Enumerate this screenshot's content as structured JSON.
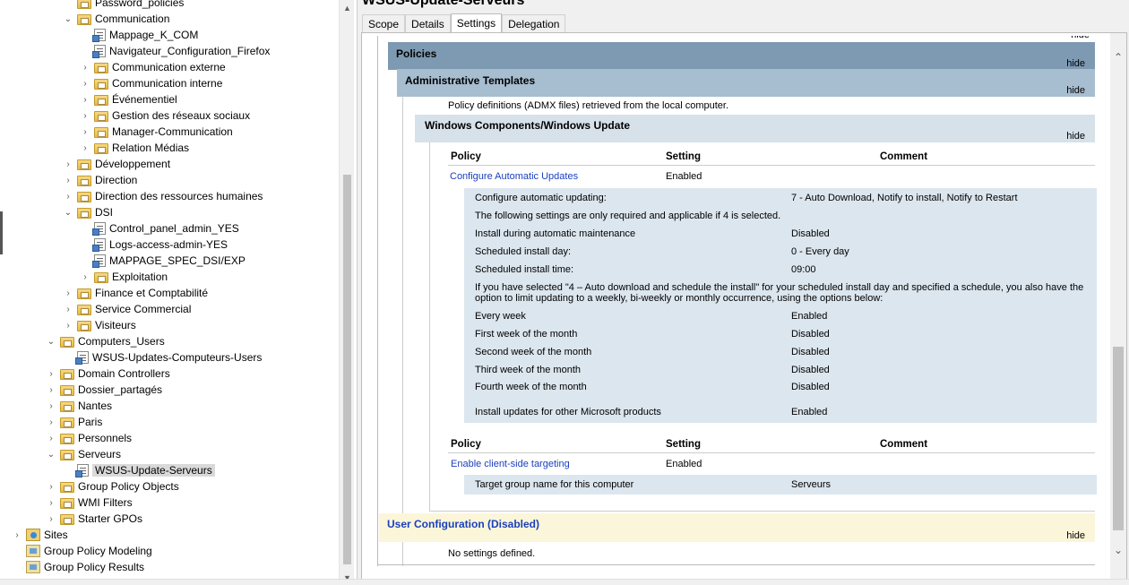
{
  "tree": {
    "items": [
      {
        "label": "Password_policies",
        "icon": "folder"
      },
      {
        "label": "Communication",
        "icon": "folder",
        "chevron": "expanded"
      },
      {
        "label": "Mappage_K_COM",
        "icon": "gpo"
      },
      {
        "label": "Navigateur_Configuration_Firefox",
        "icon": "gpo"
      },
      {
        "label": "Communication externe",
        "icon": "folder",
        "chevron": "collapsed"
      },
      {
        "label": "Communication interne",
        "icon": "folder",
        "chevron": "collapsed"
      },
      {
        "label": "Événementiel",
        "icon": "folder",
        "chevron": "collapsed"
      },
      {
        "label": "Gestion des réseaux sociaux",
        "icon": "folder",
        "chevron": "collapsed"
      },
      {
        "label": "Manager-Communication",
        "icon": "folder",
        "chevron": "collapsed"
      },
      {
        "label": "Relation Médias",
        "icon": "folder",
        "chevron": "collapsed"
      },
      {
        "label": "Développement",
        "icon": "folder",
        "chevron": "collapsed"
      },
      {
        "label": "Direction",
        "icon": "folder",
        "chevron": "collapsed"
      },
      {
        "label": "Direction des ressources humaines",
        "icon": "folder",
        "chevron": "collapsed"
      },
      {
        "label": "DSI",
        "icon": "folder",
        "chevron": "expanded"
      },
      {
        "label": "Control_panel_admin_YES",
        "icon": "gpo"
      },
      {
        "label": "Logs-access-admin-YES",
        "icon": "gpo"
      },
      {
        "label": "MAPPAGE_SPEC_DSI/EXP",
        "icon": "gpo"
      },
      {
        "label": "Exploitation",
        "icon": "folder",
        "chevron": "collapsed"
      },
      {
        "label": "Finance et Comptabilité",
        "icon": "folder",
        "chevron": "collapsed"
      },
      {
        "label": "Service Commercial",
        "icon": "folder",
        "chevron": "collapsed"
      },
      {
        "label": "Visiteurs",
        "icon": "folder",
        "chevron": "collapsed"
      },
      {
        "label": "Computers_Users",
        "icon": "folder",
        "chevron": "expanded"
      },
      {
        "label": "WSUS-Updates-Computeurs-Users",
        "icon": "gpo"
      },
      {
        "label": "Domain Controllers",
        "icon": "folder",
        "chevron": "collapsed"
      },
      {
        "label": "Dossier_partagés",
        "icon": "folder",
        "chevron": "collapsed"
      },
      {
        "label": "Nantes",
        "icon": "folder",
        "chevron": "collapsed"
      },
      {
        "label": "Paris",
        "icon": "folder",
        "chevron": "collapsed"
      },
      {
        "label": "Personnels",
        "icon": "folder",
        "chevron": "collapsed"
      },
      {
        "label": "Serveurs",
        "icon": "folder",
        "chevron": "expanded"
      },
      {
        "label": "WSUS-Update-Serveurs",
        "icon": "gpo",
        "selected": true
      },
      {
        "label": "Group Policy Objects",
        "icon": "folder",
        "chevron": "collapsed"
      },
      {
        "label": "WMI Filters",
        "icon": "folder",
        "chevron": "collapsed"
      },
      {
        "label": "Starter GPOs",
        "icon": "folder",
        "chevron": "collapsed"
      },
      {
        "label": "Sites",
        "icon": "sites",
        "chevron": "collapsed"
      },
      {
        "label": "Group Policy Modeling",
        "icon": "model"
      },
      {
        "label": "Group Policy Results",
        "icon": "model"
      }
    ]
  },
  "gpo": {
    "title": "WSUS-Update-Serveurs",
    "tabs": [
      "Scope",
      "Details",
      "Settings",
      "Delegation"
    ],
    "active_tab": "Settings"
  },
  "report": {
    "top_hide": "hide",
    "policies_header": "Policies",
    "admin_templates_header": "Administrative Templates",
    "admx_note": "Policy definitions (ADMX files) retrieved from the local computer.",
    "wu_header": "Windows Components/Windows Update",
    "hide": "hide",
    "col_policy": "Policy",
    "col_setting": "Setting",
    "col_comment": "Comment",
    "policy1": {
      "name": "Configure Automatic Updates",
      "setting": "Enabled"
    },
    "details1": [
      {
        "label": "Configure automatic updating:",
        "value": "7 - Auto Download, Notify to install, Notify to Restart"
      },
      {
        "label": "The following settings are only required and applicable if 4 is selected.",
        "value": ""
      },
      {
        "label": "Install during automatic maintenance",
        "value": "Disabled"
      },
      {
        "label": "Scheduled install day:",
        "value": "0 - Every day"
      },
      {
        "label": "Scheduled install time:",
        "value": "09:00"
      }
    ],
    "schedule_note_1": "If you have selected \"4 – Auto download and schedule the install\" for your scheduled install day and specified a schedule, you also have the",
    "schedule_note_2": "option to limit updating to a weekly, bi-weekly or monthly occurrence, using the options below:",
    "details2": [
      {
        "label": "Every week",
        "value": "Enabled"
      },
      {
        "label": "First week of the month",
        "value": "Disabled"
      },
      {
        "label": "Second week of the month",
        "value": "Disabled"
      },
      {
        "label": "Third week of the month",
        "value": "Disabled"
      },
      {
        "label": "Fourth week of the month",
        "value": "Disabled"
      },
      {
        "label": "Install updates for other Microsoft products",
        "value": "Enabled"
      }
    ],
    "policy2": {
      "name": "Enable client-side targeting",
      "setting": "Enabled"
    },
    "details3": {
      "label": "Target group name for this computer",
      "value": "Serveurs"
    },
    "user_config_header": "User Configuration (Disabled)",
    "no_settings": "No settings defined."
  },
  "colors": {
    "policies_bg": "#7d9ab2",
    "admin_bg": "#a7bdd0",
    "wu_bg": "#d6e1ea",
    "detail_bg": "#dce6ee",
    "user_bg": "#fbf6d9",
    "link": "#1a3fbf"
  }
}
